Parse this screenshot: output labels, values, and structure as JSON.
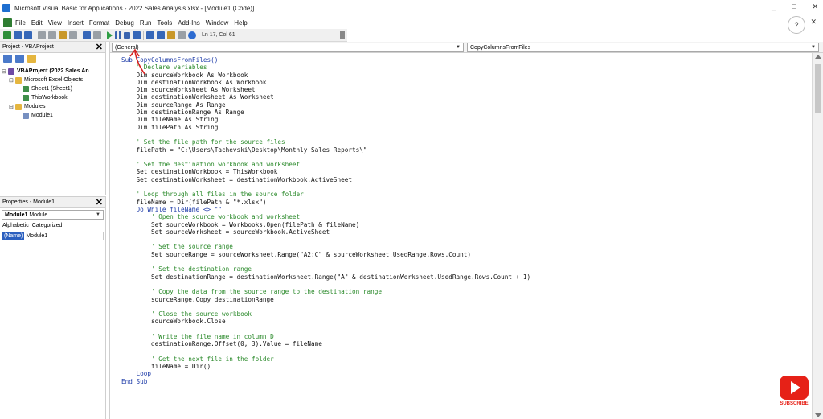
{
  "window": {
    "title": "Microsoft Visual Basic for Applications - 2022 Sales Analysis.xlsx - [Module1 (Code)]",
    "controls": [
      "_",
      "□",
      "✕"
    ]
  },
  "menu": {
    "items": [
      "File",
      "Edit",
      "View",
      "Insert",
      "Format",
      "Debug",
      "Run",
      "Tools",
      "Add-Ins",
      "Window",
      "Help"
    ],
    "close": "✕",
    "help_glyph": "?"
  },
  "toolbar": {
    "cursor_position": "Ln 17, Col 61"
  },
  "project_pane": {
    "title": "Project - VBAProject",
    "close": "✕",
    "tree": [
      {
        "label": "VBAProject (2022 Sales An",
        "expander": "⊟",
        "indent": 0,
        "icon": "project-icon",
        "bold": true
      },
      {
        "label": "Microsoft Excel Objects",
        "expander": "⊟",
        "indent": 1,
        "icon": "folder-icon",
        "bold": false
      },
      {
        "label": "Sheet1 (Sheet1)",
        "expander": "",
        "indent": 2,
        "icon": "sheet-icon",
        "bold": false
      },
      {
        "label": "ThisWorkbook",
        "expander": "",
        "indent": 2,
        "icon": "workbook-icon",
        "bold": false
      },
      {
        "label": "Modules",
        "expander": "⊟",
        "indent": 1,
        "icon": "folder-icon",
        "bold": false
      },
      {
        "label": "Module1",
        "expander": "",
        "indent": 2,
        "icon": "module-icon",
        "bold": false
      }
    ]
  },
  "properties_pane": {
    "title": "Properties - Module1",
    "close": "✕",
    "object_name": "Module1",
    "object_type": "Module",
    "tabs": [
      "Alphabetic",
      "Categorized"
    ],
    "rows": [
      {
        "key": "(Name)",
        "value": "Module1"
      }
    ]
  },
  "code_window": {
    "object_combo": "(General)",
    "procedure_combo": "CopyColumnsFromFiles",
    "lines": [
      {
        "text": "Sub CopyColumnsFromFiles()",
        "kind": "kw"
      },
      {
        "text": "    ' Declare variables",
        "kind": "comment"
      },
      {
        "text": "    Dim sourceWorkbook As Workbook",
        "kind": "code"
      },
      {
        "text": "    Dim destinationWorkbook As Workbook",
        "kind": "code"
      },
      {
        "text": "    Dim sourceWorksheet As Worksheet",
        "kind": "code"
      },
      {
        "text": "    Dim destinationWorksheet As Worksheet",
        "kind": "code"
      },
      {
        "text": "    Dim sourceRange As Range",
        "kind": "code"
      },
      {
        "text": "    Dim destinationRange As Range",
        "kind": "code"
      },
      {
        "text": "    Dim fileName As String",
        "kind": "code"
      },
      {
        "text": "    Dim filePath As String",
        "kind": "code"
      },
      {
        "text": "",
        "kind": "code"
      },
      {
        "text": "    ' Set the file path for the source files",
        "kind": "comment"
      },
      {
        "text": "    filePath = \"C:\\Users\\Tachevski\\Desktop\\Monthly Sales Reports\\\"",
        "kind": "code"
      },
      {
        "text": "",
        "kind": "code"
      },
      {
        "text": "    ' Set the destination workbook and worksheet",
        "kind": "comment"
      },
      {
        "text": "    Set destinationWorkbook = ThisWorkbook",
        "kind": "code"
      },
      {
        "text": "    Set destinationWorksheet = destinationWorkbook.ActiveSheet",
        "kind": "code"
      },
      {
        "text": "",
        "kind": "code"
      },
      {
        "text": "    ' Loop through all files in the source folder",
        "kind": "comment"
      },
      {
        "text": "    fileName = Dir(filePath & \"*.xlsx\")",
        "kind": "code"
      },
      {
        "text": "    Do While fileName <> \"\"",
        "kind": "kw"
      },
      {
        "text": "        ' Open the source workbook and worksheet",
        "kind": "comment"
      },
      {
        "text": "        Set sourceWorkbook = Workbooks.Open(filePath & fileName)",
        "kind": "code"
      },
      {
        "text": "        Set sourceWorksheet = sourceWorkbook.ActiveSheet",
        "kind": "code"
      },
      {
        "text": "",
        "kind": "code"
      },
      {
        "text": "        ' Set the source range",
        "kind": "comment"
      },
      {
        "text": "        Set sourceRange = sourceWorksheet.Range(\"A2:C\" & sourceWorksheet.UsedRange.Rows.Count)",
        "kind": "code"
      },
      {
        "text": "",
        "kind": "code"
      },
      {
        "text": "        ' Set the destination range",
        "kind": "comment"
      },
      {
        "text": "        Set destinationRange = destinationWorksheet.Range(\"A\" & destinationWorksheet.UsedRange.Rows.Count + 1)",
        "kind": "code"
      },
      {
        "text": "",
        "kind": "code"
      },
      {
        "text": "        ' Copy the data from the source range to the destination range",
        "kind": "comment"
      },
      {
        "text": "        sourceRange.Copy destinationRange",
        "kind": "code"
      },
      {
        "text": "",
        "kind": "code"
      },
      {
        "text": "        ' Close the source workbook",
        "kind": "comment"
      },
      {
        "text": "        sourceWorkbook.Close",
        "kind": "code"
      },
      {
        "text": "",
        "kind": "code"
      },
      {
        "text": "        ' Write the file name in column D",
        "kind": "comment"
      },
      {
        "text": "        destinationRange.Offset(0, 3).Value = fileName",
        "kind": "code"
      },
      {
        "text": "",
        "kind": "code"
      },
      {
        "text": "        ' Get the next file in the folder",
        "kind": "comment"
      },
      {
        "text": "        fileName = Dir()",
        "kind": "code"
      },
      {
        "text": "    Loop",
        "kind": "kw"
      },
      {
        "text": "End Sub",
        "kind": "kw"
      }
    ]
  },
  "badge": {
    "text": "SUBSCRIBE",
    "color": "#e62117"
  }
}
